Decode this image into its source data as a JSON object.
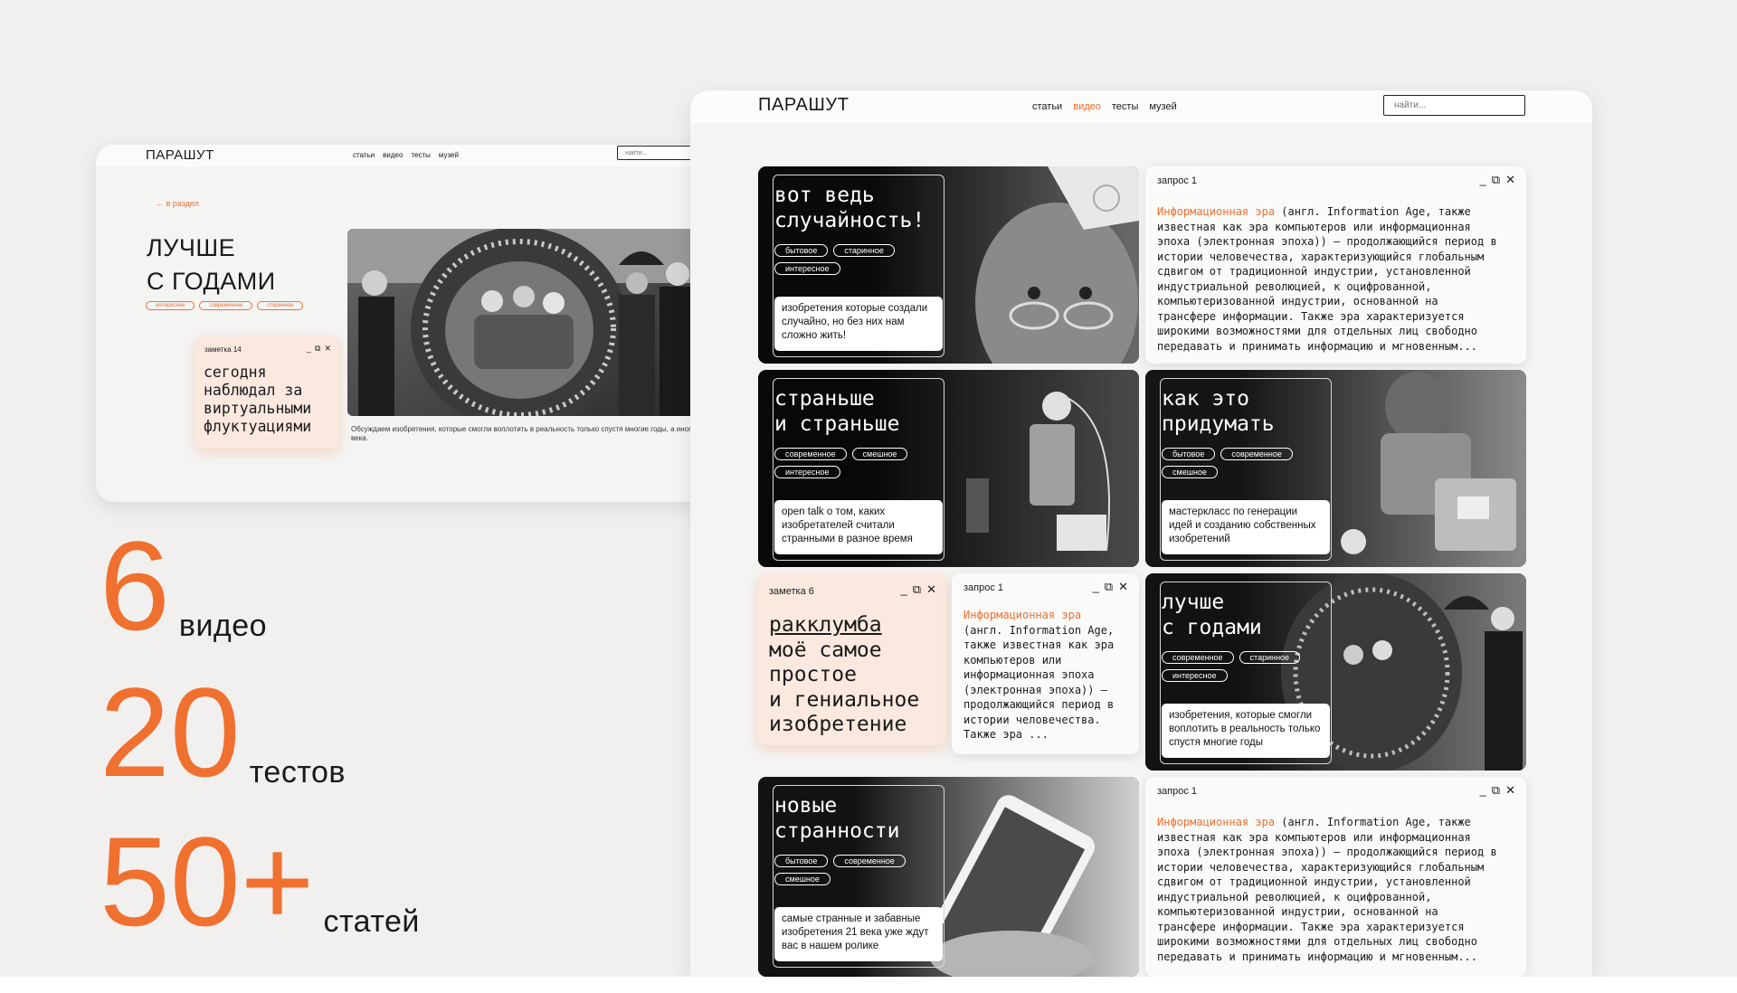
{
  "accent_color": "#f07030",
  "small_window": {
    "logo": "ПАРАШУТ",
    "nav": [
      "статьи",
      "видео",
      "тесты",
      "музей"
    ],
    "search_placeholder": "найти...",
    "back_link": "← в раздел",
    "title_line1": "ЛУЧШЕ",
    "title_line2": "С ГОДАМИ",
    "tags": [
      "интересное",
      "современное",
      "старинное"
    ],
    "caption": "Обсуждаем изобретения, которые смогли воплотить в реальность только спустя многие годы, а иногда и века.",
    "note": {
      "header": "заметка 14",
      "controls": [
        "_",
        "⧉",
        "✕"
      ],
      "text": "сегодня наблюдал за виртуальными флуктуациями"
    }
  },
  "stats": [
    {
      "number": "6",
      "label": "видео"
    },
    {
      "number": "20",
      "label": "тестов"
    },
    {
      "number": "50+",
      "label": "статей"
    }
  ],
  "big_window": {
    "logo": "ПАРАШУТ",
    "nav": [
      "статьи",
      "видео",
      "тесты",
      "музей"
    ],
    "active_nav": "видео",
    "search_placeholder": "найти...",
    "video_cards": [
      {
        "title": "вот ведь\nслучайность!",
        "tags": [
          "бытовое",
          "старинное",
          "интересное"
        ],
        "description": "изобретения которые создали случайно, но без них нам сложно жить!"
      },
      {
        "title": "страньше\nи страньше",
        "tags": [
          "современное",
          "смешное",
          "интересное"
        ],
        "description": "open talk о том, каких изобретателей считали странными в разное время"
      },
      {
        "title": "как это\nпридумать",
        "tags": [
          "бытовое",
          "современное",
          "смешное"
        ],
        "description": "мастеркласс по генерации идей и созданию собственных изобретений"
      },
      {
        "title": "лучше\nс годами",
        "tags": [
          "современное",
          "старинное",
          "интересное"
        ],
        "description": "изобретения, которые смогли воплотить в реальность только спустя многие годы"
      },
      {
        "title": "новые\nстранности",
        "tags": [
          "бытовое",
          "современное",
          "смешное"
        ],
        "description": "самые странные и забавные изобретения 21 века уже ждут вас в нашем ролике"
      }
    ],
    "request_header": "запрос 1",
    "request_term": "Информационная эра",
    "request_wide_rest": " (англ. Information Age, также\nизвестная как эра компьютеров или информационная\nэпоха (электронная эпоха)) — продолжающийся период в\nистории человечества, характеризующийся глобальным\nсдвигом от традиционной индустрии, установленной\nиндустриальной революцией, к оцифрованной,\nкомпьютеризованной индустрии, основанной на\nтрансфере информации. Также эра характеризуется\nширокими возможностями для отдельных лиц свободно\nпередавать и принимать информацию и мгновенным...",
    "request_narrow_rest": "(англ. Information Age,\nтакже известная как эра\nкомпьютеров или\nинформационная эпоха\n(электронная эпоха)) —\nпродолжающийся период в\nистории человечества.\nТакже эра ...",
    "request_controls": [
      "_",
      "⧉",
      "✕"
    ],
    "note": {
      "header": "заметка 6",
      "title": "ракклумба",
      "text": "моё самое\nпростое\nи гениальное\nизобретение"
    }
  }
}
